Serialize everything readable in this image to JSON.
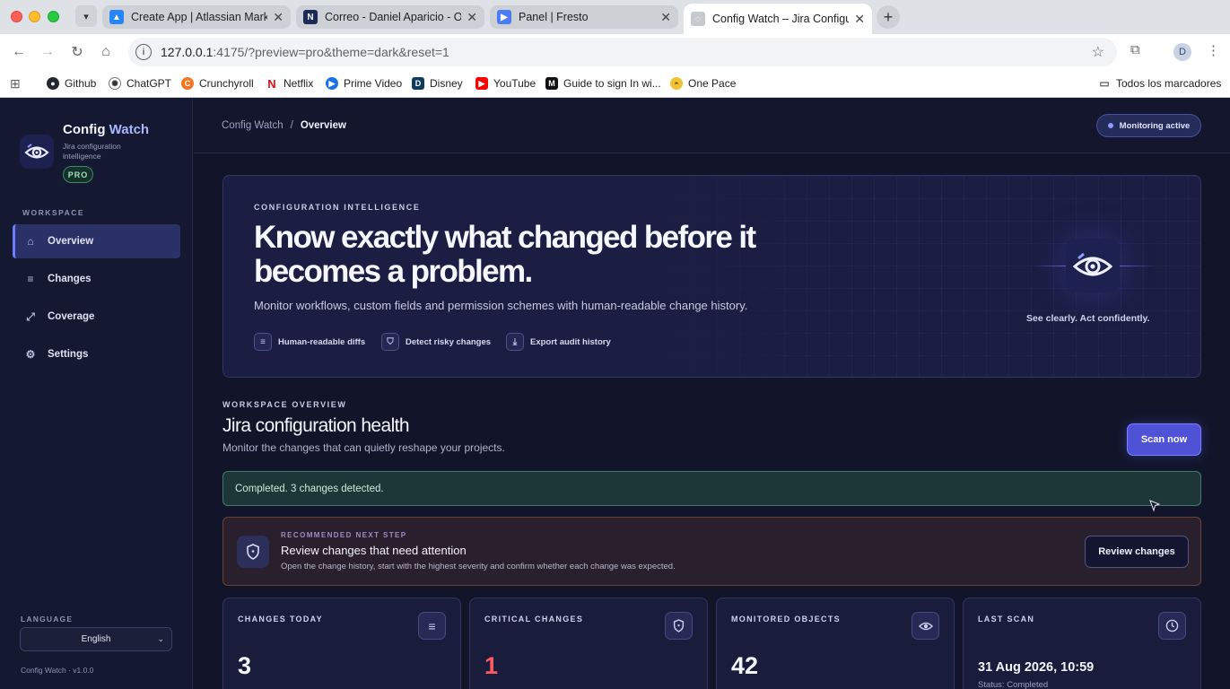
{
  "browser": {
    "tabs": [
      {
        "title": "Create App | Atlassian Marketplace",
        "active": false
      },
      {
        "title": "Correo - Daniel Aparicio - Outlook",
        "active": false
      },
      {
        "title": "Panel | Fresto",
        "active": false
      },
      {
        "title": "Config Watch – Jira Configuration",
        "active": true
      }
    ],
    "url_host": "127.0.0.1",
    "url_rest": ":4175/?preview=pro&theme=dark&reset=1",
    "profile_initial": "D",
    "bookmarks": [
      "Github",
      "ChatGPT",
      "Crunchyroll",
      "Netflix",
      "Prime Video",
      "Disney",
      "YouTube",
      "Guide to sign In wi...",
      "One Pace"
    ],
    "all_bookmarks": "Todos los marcadores"
  },
  "sidebar": {
    "brand_name_1": "Config",
    "brand_name_2": "Watch",
    "brand_subtitle": "Jira configuration intelligence",
    "plan_badge": "PRO",
    "section_label": "WORKSPACE",
    "items": [
      {
        "label": "Overview",
        "icon": "home-icon",
        "active": true
      },
      {
        "label": "Changes",
        "icon": "list-icon",
        "active": false
      },
      {
        "label": "Coverage",
        "icon": "trend-icon",
        "active": false
      },
      {
        "label": "Settings",
        "icon": "gear-icon",
        "active": false
      }
    ],
    "language_label": "LANGUAGE",
    "language_value": "English",
    "version": "Config Watch · v1.0.0"
  },
  "topbar": {
    "breadcrumb_root": "Config Watch",
    "breadcrumb_sep": "/",
    "breadcrumb_current": "Overview",
    "status": "Monitoring active"
  },
  "hero": {
    "eyebrow": "CONFIGURATION INTELLIGENCE",
    "title": "Know exactly what changed before it becomes a problem.",
    "subtitle": "Monitor workflows, custom fields and permission schemes with human-readable change history.",
    "features": [
      {
        "label": "Human-readable diffs",
        "icon": "list-icon"
      },
      {
        "label": "Detect risky changes",
        "icon": "shield-icon"
      },
      {
        "label": "Export audit history",
        "icon": "download-icon"
      }
    ],
    "caption": "See clearly. Act confidently."
  },
  "overview": {
    "eyebrow": "WORKSPACE OVERVIEW",
    "title": "Jira configuration health",
    "subtitle": "Monitor the changes that can quietly reshape your projects.",
    "scan_button": "Scan now",
    "success_message": "Completed. 3 changes detected."
  },
  "recommendation": {
    "eyebrow": "RECOMMENDED NEXT STEP",
    "title": "Review changes that need attention",
    "description": "Open the change history, start with the highest severity and confirm whether each change was expected.",
    "button": "Review changes"
  },
  "stats": [
    {
      "label": "CHANGES TODAY",
      "value": "3",
      "icon": "list-icon"
    },
    {
      "label": "CRITICAL CHANGES",
      "value": "1",
      "icon": "shield-icon",
      "color": "#ff5a5f"
    },
    {
      "label": "MONITORED OBJECTS",
      "value": "42",
      "icon": "eye-icon"
    },
    {
      "label": "LAST SCAN",
      "value": "31 Aug 2026, 10:59",
      "footer": "Status: Completed",
      "icon": "clock-icon"
    }
  ],
  "colors": {
    "accent": "#4f51d6",
    "background": "#12152a",
    "critical": "#ff5a5f",
    "success": "#3f7a68"
  }
}
